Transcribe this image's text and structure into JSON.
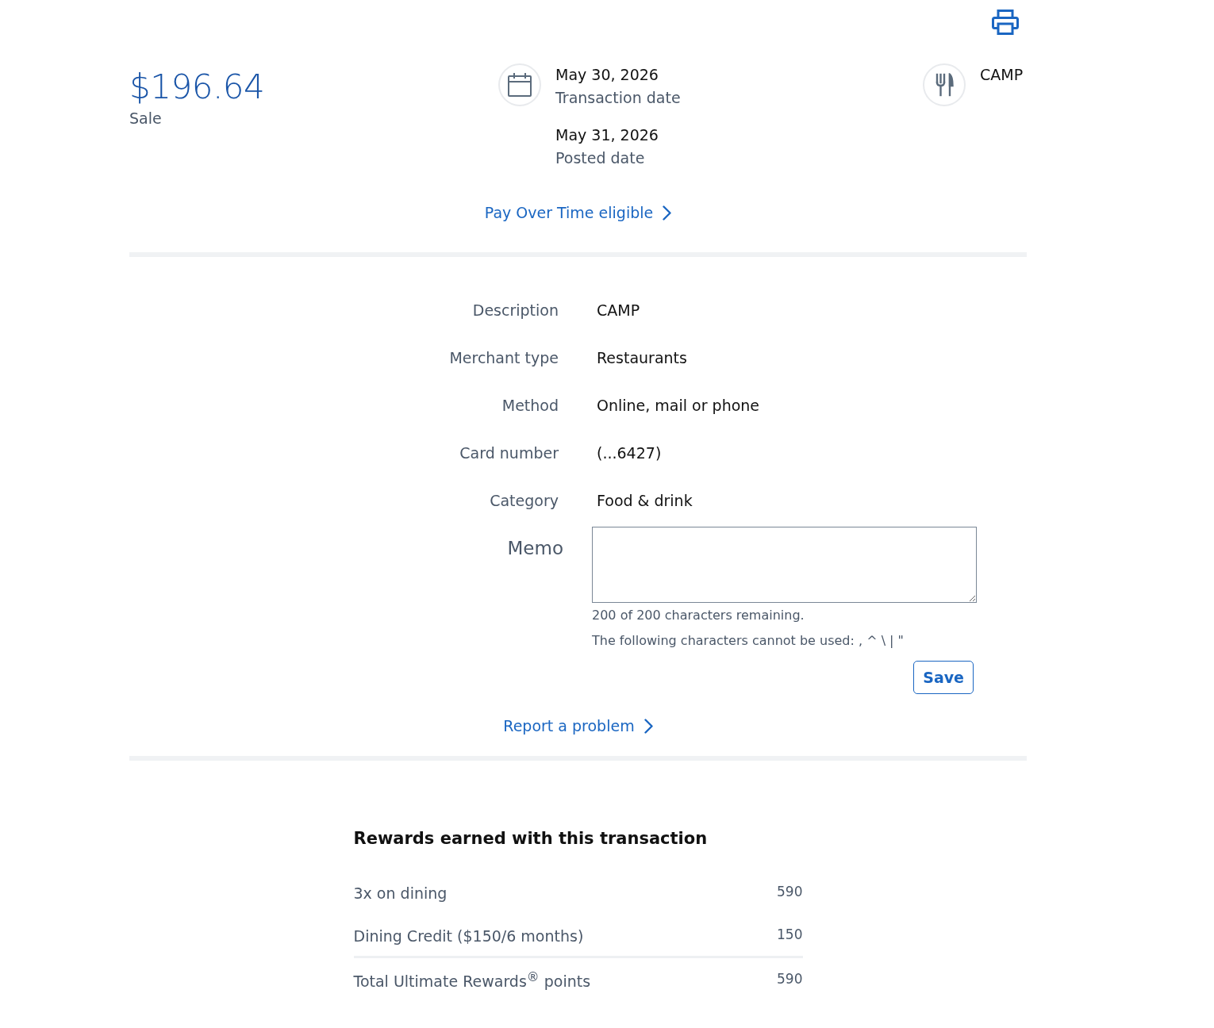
{
  "summary": {
    "amount": "$196.64",
    "type": "Sale"
  },
  "dates": [
    {
      "value": "May 30, 2026",
      "label": "Transaction date"
    },
    {
      "value": "May 31, 2026",
      "label": "Posted date"
    }
  ],
  "merchant": {
    "name": "CAMP"
  },
  "pay_over_time_link": "Pay Over Time eligible",
  "details": [
    {
      "label": "Description",
      "value": "CAMP"
    },
    {
      "label": "Merchant type",
      "value": "Restaurants"
    },
    {
      "label": "Method",
      "value": "Online, mail or phone"
    },
    {
      "label": "Card number",
      "value": "(...6427)"
    },
    {
      "label": "Category",
      "value": "Food & drink"
    }
  ],
  "memo": {
    "label": "Memo",
    "remaining": "200 of 200 characters remaining.",
    "restriction": "The following characters cannot be used: , ^ \\ | \"",
    "save_button": "Save"
  },
  "report_link": "Report a problem",
  "rewards": {
    "title": "Rewards earned with this transaction",
    "rows": [
      {
        "label": "3x on dining",
        "points": "590"
      },
      {
        "label": "Dining Credit ($150/6 months)",
        "points": "150"
      }
    ],
    "total": {
      "label": "Total Ultimate Rewards$^{®}$ points",
      "points": "590"
    }
  }
}
